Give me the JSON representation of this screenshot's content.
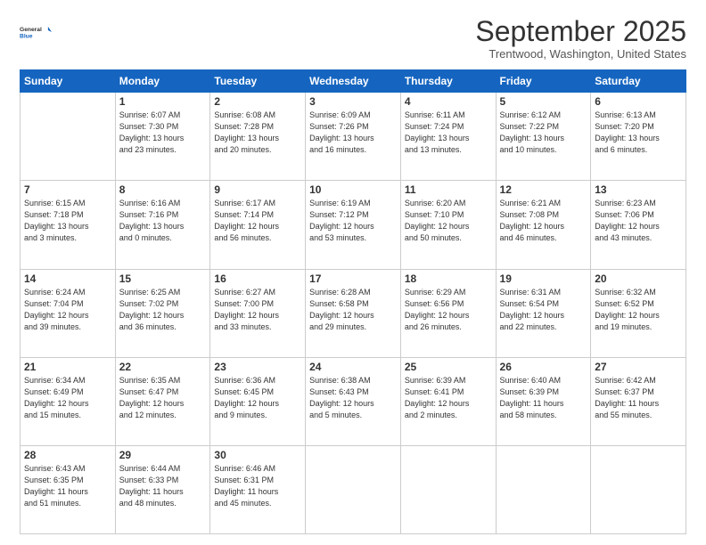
{
  "logo": {
    "general": "General",
    "blue": "Blue"
  },
  "header": {
    "month": "September 2025",
    "location": "Trentwood, Washington, United States"
  },
  "weekdays": [
    "Sunday",
    "Monday",
    "Tuesday",
    "Wednesday",
    "Thursday",
    "Friday",
    "Saturday"
  ],
  "weeks": [
    [
      {
        "day": "",
        "info": ""
      },
      {
        "day": "1",
        "info": "Sunrise: 6:07 AM\nSunset: 7:30 PM\nDaylight: 13 hours\nand 23 minutes."
      },
      {
        "day": "2",
        "info": "Sunrise: 6:08 AM\nSunset: 7:28 PM\nDaylight: 13 hours\nand 20 minutes."
      },
      {
        "day": "3",
        "info": "Sunrise: 6:09 AM\nSunset: 7:26 PM\nDaylight: 13 hours\nand 16 minutes."
      },
      {
        "day": "4",
        "info": "Sunrise: 6:11 AM\nSunset: 7:24 PM\nDaylight: 13 hours\nand 13 minutes."
      },
      {
        "day": "5",
        "info": "Sunrise: 6:12 AM\nSunset: 7:22 PM\nDaylight: 13 hours\nand 10 minutes."
      },
      {
        "day": "6",
        "info": "Sunrise: 6:13 AM\nSunset: 7:20 PM\nDaylight: 13 hours\nand 6 minutes."
      }
    ],
    [
      {
        "day": "7",
        "info": "Sunrise: 6:15 AM\nSunset: 7:18 PM\nDaylight: 13 hours\nand 3 minutes."
      },
      {
        "day": "8",
        "info": "Sunrise: 6:16 AM\nSunset: 7:16 PM\nDaylight: 13 hours\nand 0 minutes."
      },
      {
        "day": "9",
        "info": "Sunrise: 6:17 AM\nSunset: 7:14 PM\nDaylight: 12 hours\nand 56 minutes."
      },
      {
        "day": "10",
        "info": "Sunrise: 6:19 AM\nSunset: 7:12 PM\nDaylight: 12 hours\nand 53 minutes."
      },
      {
        "day": "11",
        "info": "Sunrise: 6:20 AM\nSunset: 7:10 PM\nDaylight: 12 hours\nand 50 minutes."
      },
      {
        "day": "12",
        "info": "Sunrise: 6:21 AM\nSunset: 7:08 PM\nDaylight: 12 hours\nand 46 minutes."
      },
      {
        "day": "13",
        "info": "Sunrise: 6:23 AM\nSunset: 7:06 PM\nDaylight: 12 hours\nand 43 minutes."
      }
    ],
    [
      {
        "day": "14",
        "info": "Sunrise: 6:24 AM\nSunset: 7:04 PM\nDaylight: 12 hours\nand 39 minutes."
      },
      {
        "day": "15",
        "info": "Sunrise: 6:25 AM\nSunset: 7:02 PM\nDaylight: 12 hours\nand 36 minutes."
      },
      {
        "day": "16",
        "info": "Sunrise: 6:27 AM\nSunset: 7:00 PM\nDaylight: 12 hours\nand 33 minutes."
      },
      {
        "day": "17",
        "info": "Sunrise: 6:28 AM\nSunset: 6:58 PM\nDaylight: 12 hours\nand 29 minutes."
      },
      {
        "day": "18",
        "info": "Sunrise: 6:29 AM\nSunset: 6:56 PM\nDaylight: 12 hours\nand 26 minutes."
      },
      {
        "day": "19",
        "info": "Sunrise: 6:31 AM\nSunset: 6:54 PM\nDaylight: 12 hours\nand 22 minutes."
      },
      {
        "day": "20",
        "info": "Sunrise: 6:32 AM\nSunset: 6:52 PM\nDaylight: 12 hours\nand 19 minutes."
      }
    ],
    [
      {
        "day": "21",
        "info": "Sunrise: 6:34 AM\nSunset: 6:49 PM\nDaylight: 12 hours\nand 15 minutes."
      },
      {
        "day": "22",
        "info": "Sunrise: 6:35 AM\nSunset: 6:47 PM\nDaylight: 12 hours\nand 12 minutes."
      },
      {
        "day": "23",
        "info": "Sunrise: 6:36 AM\nSunset: 6:45 PM\nDaylight: 12 hours\nand 9 minutes."
      },
      {
        "day": "24",
        "info": "Sunrise: 6:38 AM\nSunset: 6:43 PM\nDaylight: 12 hours\nand 5 minutes."
      },
      {
        "day": "25",
        "info": "Sunrise: 6:39 AM\nSunset: 6:41 PM\nDaylight: 12 hours\nand 2 minutes."
      },
      {
        "day": "26",
        "info": "Sunrise: 6:40 AM\nSunset: 6:39 PM\nDaylight: 11 hours\nand 58 minutes."
      },
      {
        "day": "27",
        "info": "Sunrise: 6:42 AM\nSunset: 6:37 PM\nDaylight: 11 hours\nand 55 minutes."
      }
    ],
    [
      {
        "day": "28",
        "info": "Sunrise: 6:43 AM\nSunset: 6:35 PM\nDaylight: 11 hours\nand 51 minutes."
      },
      {
        "day": "29",
        "info": "Sunrise: 6:44 AM\nSunset: 6:33 PM\nDaylight: 11 hours\nand 48 minutes."
      },
      {
        "day": "30",
        "info": "Sunrise: 6:46 AM\nSunset: 6:31 PM\nDaylight: 11 hours\nand 45 minutes."
      },
      {
        "day": "",
        "info": ""
      },
      {
        "day": "",
        "info": ""
      },
      {
        "day": "",
        "info": ""
      },
      {
        "day": "",
        "info": ""
      }
    ]
  ]
}
